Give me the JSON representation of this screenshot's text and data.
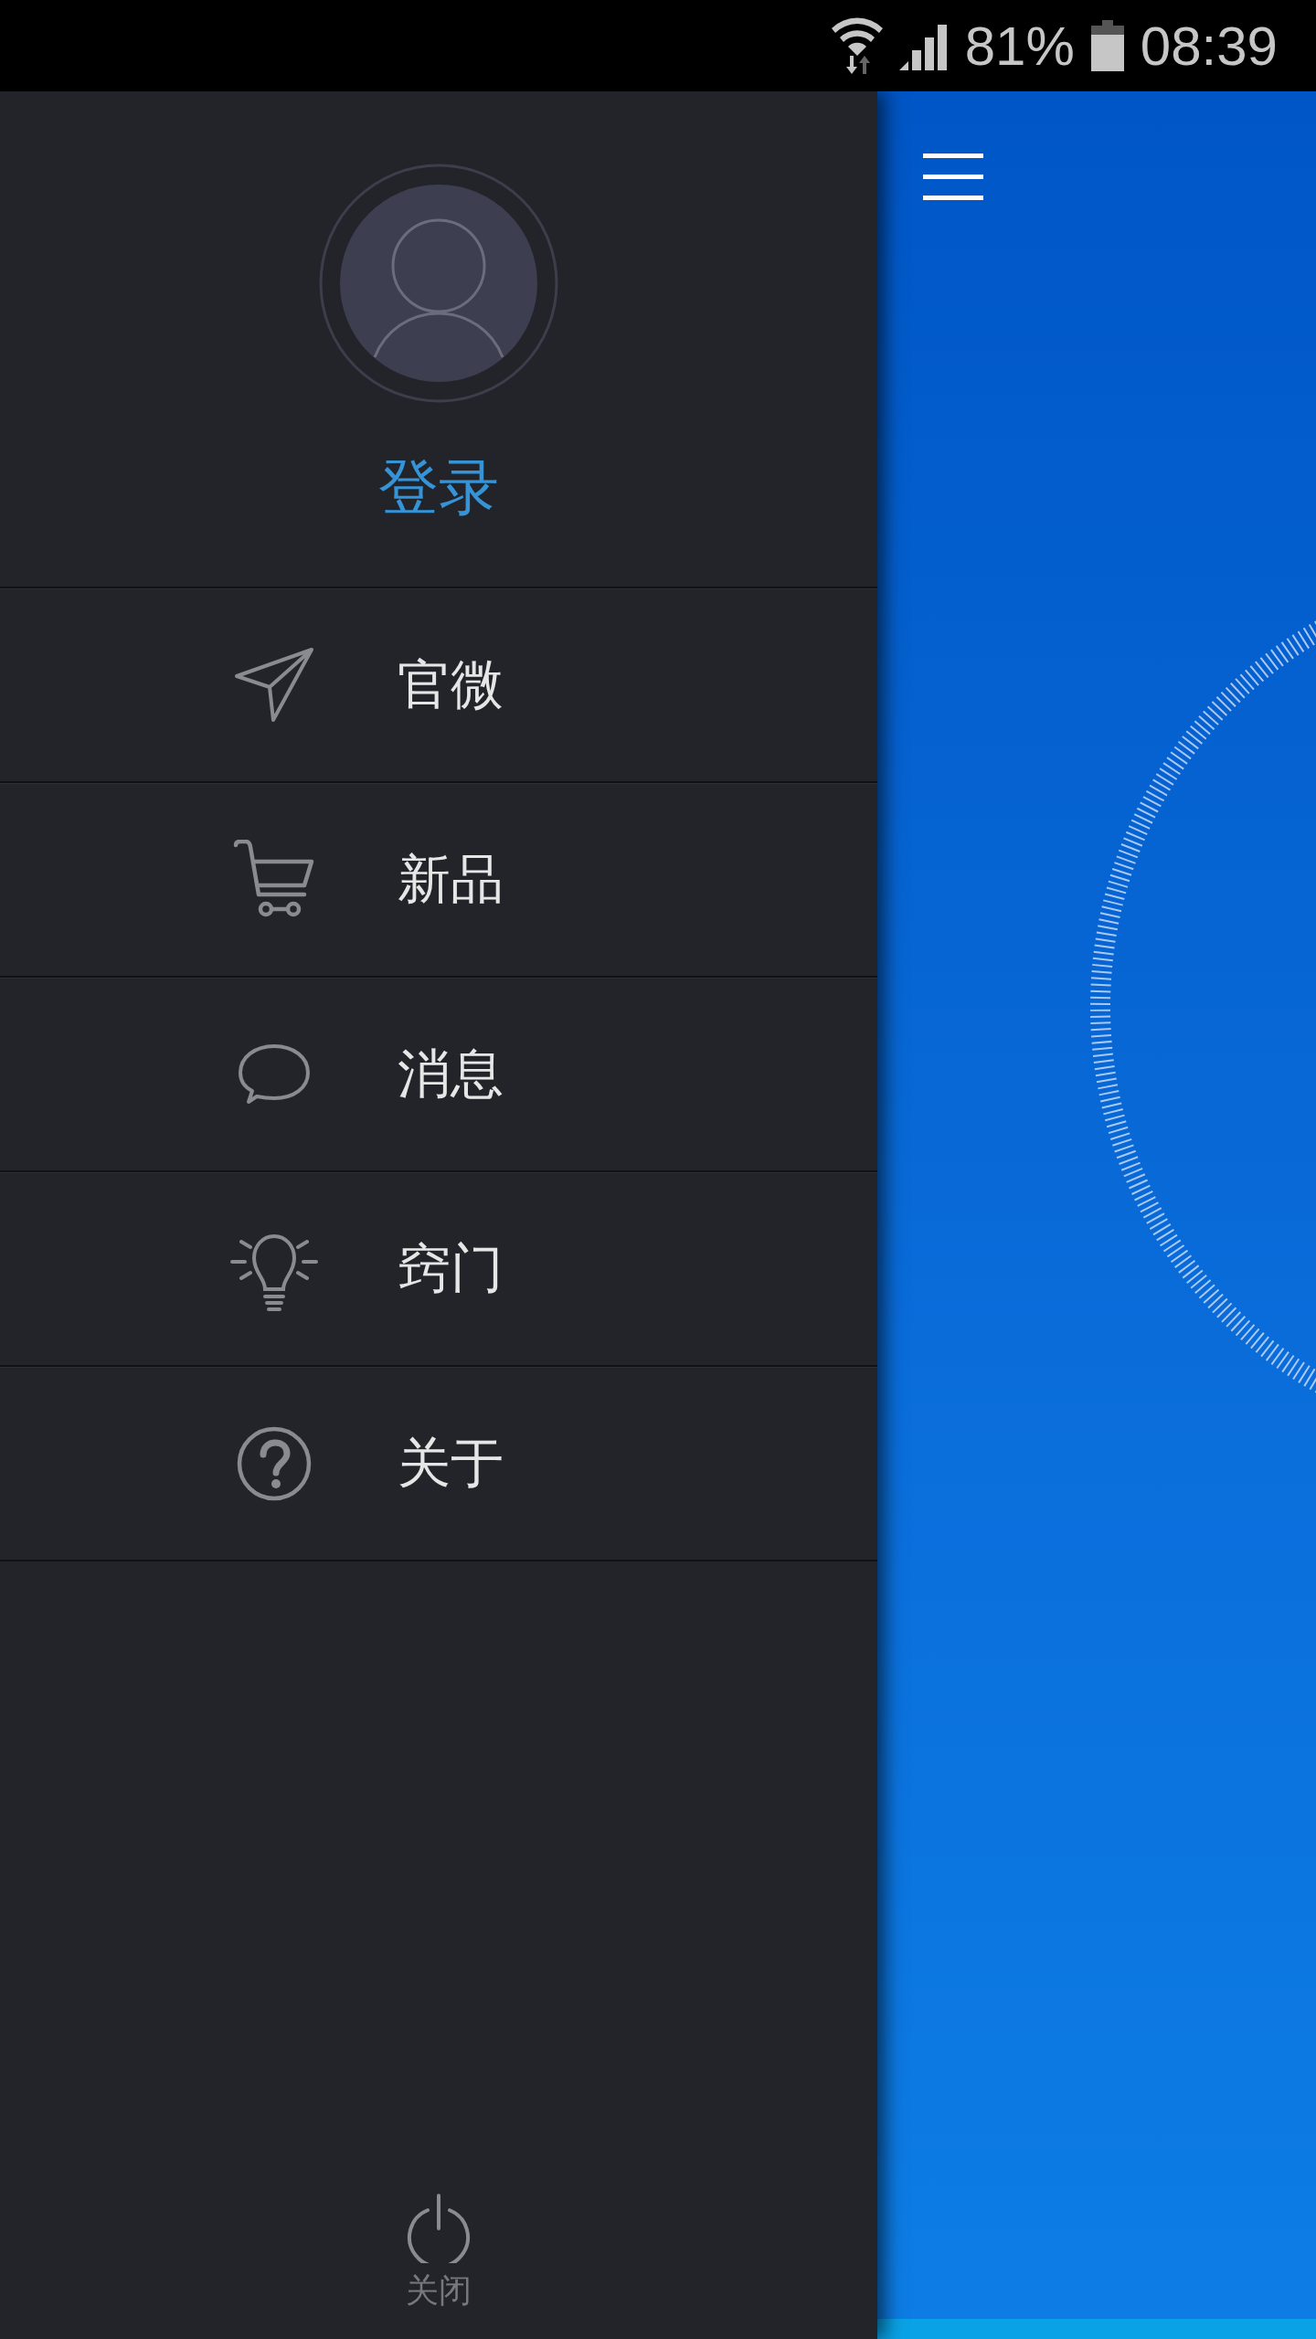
{
  "status_bar": {
    "battery": "81%",
    "time": "08:39"
  },
  "drawer": {
    "login": "登录",
    "items": [
      {
        "kind": "send",
        "label": "官微"
      },
      {
        "kind": "cart",
        "label": "新品"
      },
      {
        "kind": "chat",
        "label": "消息"
      },
      {
        "kind": "bulb",
        "label": "窍门"
      },
      {
        "kind": "help",
        "label": "关于"
      }
    ],
    "close": "关闭"
  }
}
